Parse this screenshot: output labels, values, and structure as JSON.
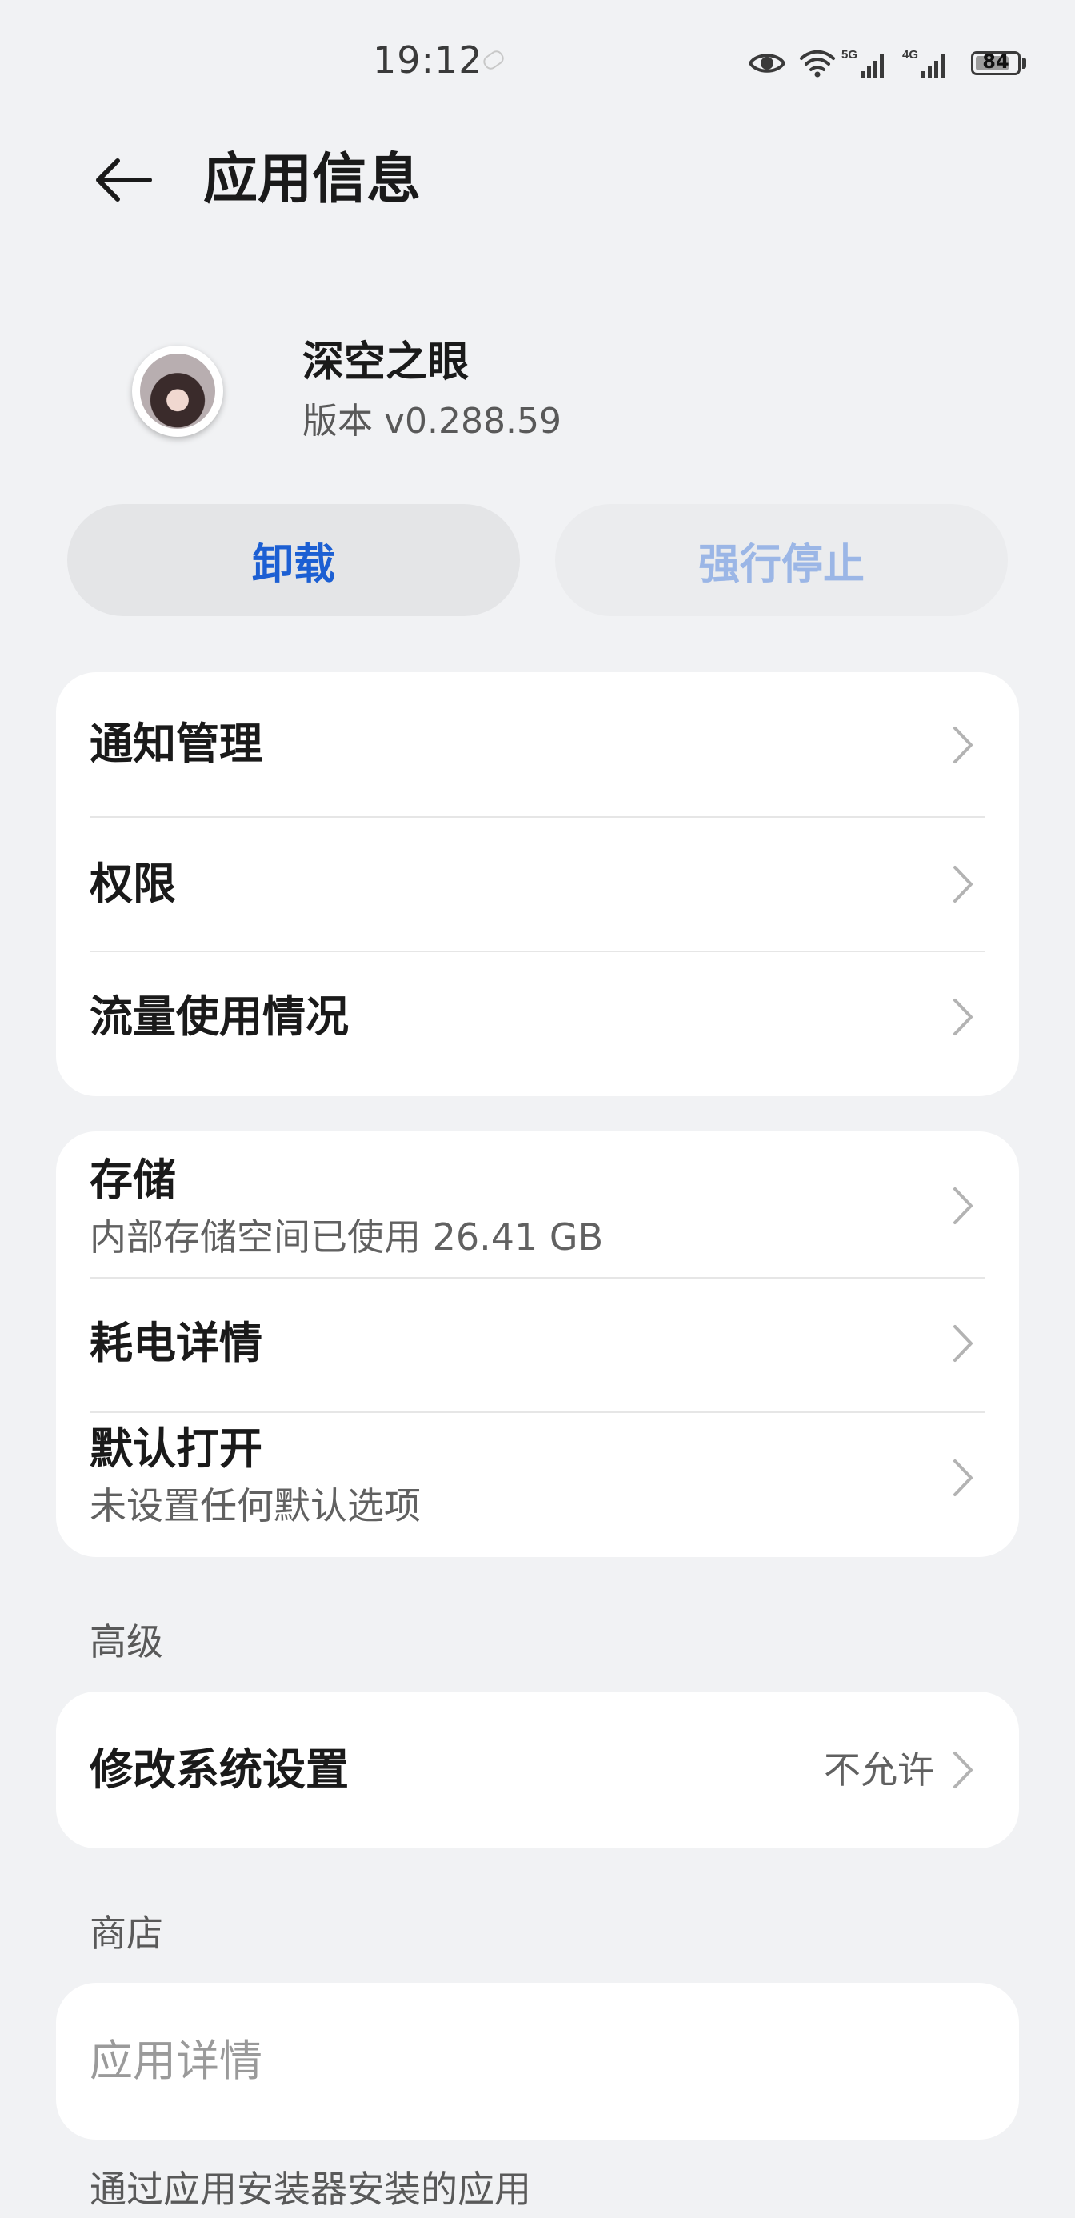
{
  "status_bar": {
    "time": "19:12",
    "net_5g": "5G",
    "net_4g": "4G",
    "battery_level": "84",
    "icons": [
      "link-icon",
      "eye-icon",
      "wifi-icon",
      "signal-5g-icon",
      "signal-4g-icon",
      "battery-icon"
    ]
  },
  "header": {
    "back_icon": "arrow-left-icon",
    "title": "应用信息"
  },
  "app": {
    "name": "深空之眼",
    "version": "版本 v0.288.59",
    "icon": "app-avatar-icon"
  },
  "actions": {
    "uninstall": "卸载",
    "force_stop": "强行停止"
  },
  "group1": {
    "items": [
      {
        "title": "通知管理"
      },
      {
        "title": "权限"
      },
      {
        "title": "流量使用情况"
      }
    ]
  },
  "group2": {
    "items": [
      {
        "title": "存储",
        "subtitle": "内部存储空间已使用 26.41 GB"
      },
      {
        "title": "耗电详情"
      },
      {
        "title": "默认打开",
        "subtitle": "未设置任何默认选项"
      }
    ]
  },
  "advanced": {
    "label": "高级",
    "items": [
      {
        "title": "修改系统设置",
        "value": "不允许"
      }
    ]
  },
  "store": {
    "label": "商店",
    "items": [
      {
        "title": "应用详情"
      }
    ]
  },
  "footer_note": "通过应用安装器安装的应用",
  "colors": {
    "background": "#f1f2f4",
    "card": "#ffffff",
    "accent": "#1c5fd3",
    "accent_disabled": "#9bb6e6",
    "button_bg": "#e4e5e7"
  }
}
